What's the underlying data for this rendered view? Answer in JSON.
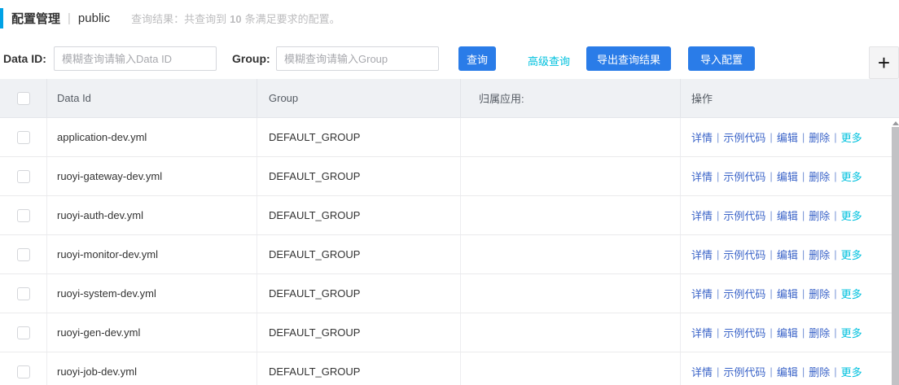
{
  "header": {
    "title": "配置管理",
    "separator": "|",
    "namespace": "public",
    "summary_prefix": "查询结果：共查询到",
    "summary_count": "10",
    "summary_suffix": "条满足要求的配置。"
  },
  "toolbar": {
    "data_id_label": "Data ID:",
    "data_id_placeholder": "模糊查询请输入Data ID",
    "group_label": "Group:",
    "group_placeholder": "模糊查询请输入Group",
    "query_button": "查询",
    "advanced_query_link": "高级查询",
    "export_button": "导出查询结果",
    "import_button": "导入配置",
    "add_button": "+"
  },
  "table": {
    "columns": {
      "data_id": "Data Id",
      "group": "Group",
      "app": "归属应用:",
      "actions": "操作"
    },
    "action_separator": "|",
    "action_links": [
      {
        "label": "详情",
        "name": "detail-link",
        "accent": false
      },
      {
        "label": "示例代码",
        "name": "sample-code-link",
        "accent": false
      },
      {
        "label": "编辑",
        "name": "edit-link",
        "accent": false
      },
      {
        "label": "删除",
        "name": "delete-link",
        "accent": false
      },
      {
        "label": "更多",
        "name": "more-link",
        "accent": true
      }
    ],
    "rows": [
      {
        "data_id": "application-dev.yml",
        "group": "DEFAULT_GROUP",
        "app": ""
      },
      {
        "data_id": "ruoyi-gateway-dev.yml",
        "group": "DEFAULT_GROUP",
        "app": ""
      },
      {
        "data_id": "ruoyi-auth-dev.yml",
        "group": "DEFAULT_GROUP",
        "app": ""
      },
      {
        "data_id": "ruoyi-monitor-dev.yml",
        "group": "DEFAULT_GROUP",
        "app": ""
      },
      {
        "data_id": "ruoyi-system-dev.yml",
        "group": "DEFAULT_GROUP",
        "app": ""
      },
      {
        "data_id": "ruoyi-gen-dev.yml",
        "group": "DEFAULT_GROUP",
        "app": ""
      },
      {
        "data_id": "ruoyi-job-dev.yml",
        "group": "DEFAULT_GROUP",
        "app": ""
      }
    ]
  },
  "colors": {
    "primary_button": "#2a7ce8",
    "link_blue": "#3b64c8",
    "accent_cyan": "#00c1de",
    "title_bar": "#00a2e6",
    "table_header_bg": "#eff1f4"
  }
}
